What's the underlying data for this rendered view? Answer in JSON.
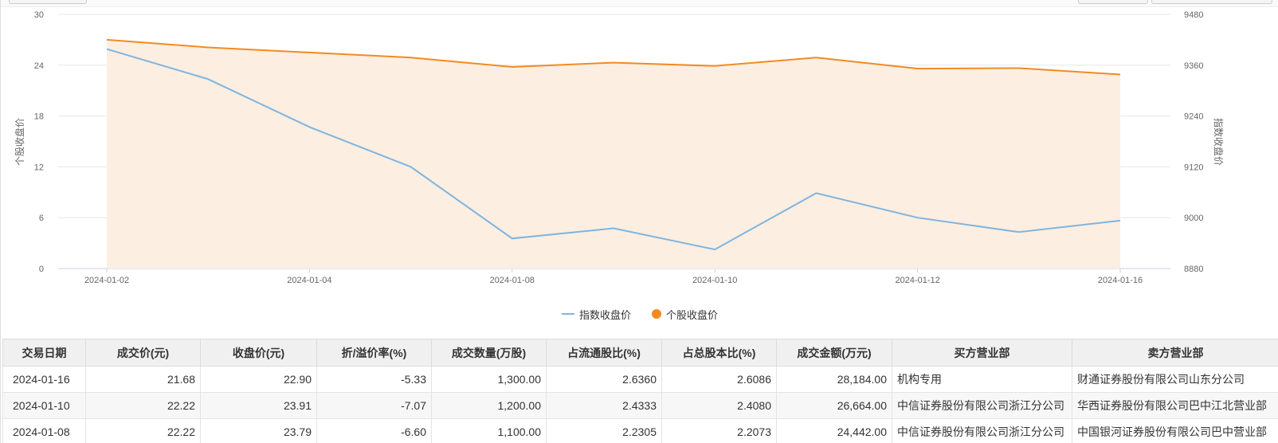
{
  "chart_data": {
    "type": "line",
    "x": [
      "2024-01-02",
      "2024-01-03",
      "2024-01-04",
      "2024-01-05",
      "2024-01-08",
      "2024-01-09",
      "2024-01-10",
      "2024-01-11",
      "2024-01-12",
      "2024-01-15",
      "2024-01-16"
    ],
    "x_tick_labels": [
      "2024-01-02",
      "2024-01-04",
      "2024-01-08",
      "2024-01-10",
      "2024-01-12",
      "2024-01-16"
    ],
    "y_left": {
      "label": "个股收盘价",
      "ticks": [
        "30",
        "24",
        "18",
        "12",
        "6",
        "0"
      ],
      "range": [
        0,
        30
      ]
    },
    "y_right": {
      "label": "指数收盘价",
      "ticks": [
        "9480",
        "9360",
        "9240",
        "9120",
        "9000",
        "8880"
      ],
      "range": [
        8880,
        9480
      ]
    },
    "series": [
      {
        "name": "指数收盘价",
        "axis": "right",
        "style": "line",
        "color": "#7eb5de",
        "values": [
          9398,
          9327,
          9214,
          9120,
          8951,
          8975,
          8925,
          9058,
          9000,
          8966,
          8993
        ]
      },
      {
        "name": "个股收盘价",
        "axis": "left",
        "style": "area",
        "color": "#f28b1f",
        "fill": "#fdeee2",
        "values": [
          27.0,
          26.1,
          25.5,
          24.9,
          23.79,
          24.3,
          23.91,
          24.9,
          23.6,
          23.65,
          22.9
        ]
      }
    ],
    "grid": true,
    "legend_position": "bottom-center"
  },
  "table": {
    "headers": [
      "交易日期",
      "成交价(元)",
      "收盘价(元)",
      "折/溢价率(%)",
      "成交数量(万股)",
      "占流通股比(%)",
      "占总股本比(%)",
      "成交金额(万元)",
      "买方营业部",
      "卖方营业部"
    ],
    "rows": [
      [
        "2024-01-16",
        "21.68",
        "22.90",
        "-5.33",
        "1,300.00",
        "2.6360",
        "2.6086",
        "28,184.00",
        "机构专用",
        "财通证券股份有限公司山东分公司"
      ],
      [
        "2024-01-10",
        "22.22",
        "23.91",
        "-7.07",
        "1,200.00",
        "2.4333",
        "2.4080",
        "26,664.00",
        "中信证券股份有限公司浙江分公司",
        "华西证券股份有限公司巴中江北营业部"
      ],
      [
        "2024-01-08",
        "22.22",
        "23.79",
        "-6.60",
        "1,100.00",
        "2.2305",
        "2.2073",
        "24,442.00",
        "中信证券股份有限公司浙江分公司",
        "中国银河证券股份有限公司巴中营业部"
      ]
    ]
  }
}
